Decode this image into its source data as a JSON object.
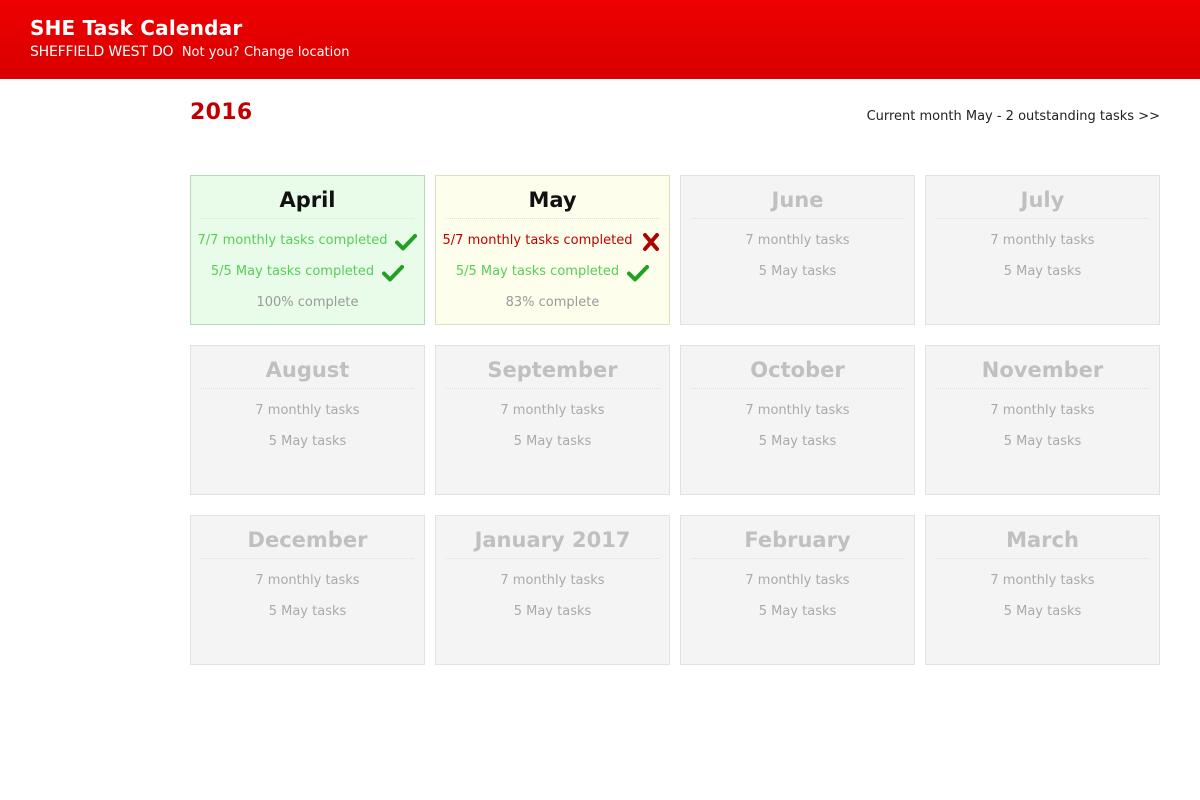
{
  "header": {
    "title": "SHE Task Calendar",
    "location": "SHEFFIELD WEST DO",
    "not_you": "Not you?",
    "change_link": "Change location"
  },
  "year": "2016",
  "current_month_link": "Current month May - 2 outstanding tasks >>",
  "colors": {
    "header_red": "#e80000",
    "year_red": "#c00000",
    "complete_green": "#55d055",
    "tick_green": "#22a022",
    "cross_red": "#b00000"
  },
  "months": [
    {
      "name": "April",
      "state": "completed",
      "lines": [
        {
          "text": "7/7 monthly tasks completed",
          "status": "ok",
          "icon": "check-icon"
        },
        {
          "text": "5/5 May tasks completed",
          "status": "ok",
          "icon": "check-icon"
        }
      ],
      "percent": "100% complete"
    },
    {
      "name": "May",
      "state": "current",
      "lines": [
        {
          "text": "5/7 monthly tasks completed",
          "status": "bad",
          "icon": "cross-icon"
        },
        {
          "text": "5/5 May tasks completed",
          "status": "ok",
          "icon": "check-icon"
        }
      ],
      "percent": "83% complete"
    },
    {
      "name": "June",
      "state": "future",
      "lines": [
        {
          "text": "7 monthly tasks"
        },
        {
          "text": "5 May tasks"
        }
      ]
    },
    {
      "name": "July",
      "state": "future",
      "lines": [
        {
          "text": "7 monthly tasks"
        },
        {
          "text": "5 May tasks"
        }
      ]
    },
    {
      "name": "August",
      "state": "future",
      "lines": [
        {
          "text": "7 monthly tasks"
        },
        {
          "text": "5 May tasks"
        }
      ]
    },
    {
      "name": "September",
      "state": "future",
      "lines": [
        {
          "text": "7 monthly tasks"
        },
        {
          "text": "5 May tasks"
        }
      ]
    },
    {
      "name": "October",
      "state": "future",
      "lines": [
        {
          "text": "7 monthly tasks"
        },
        {
          "text": "5 May tasks"
        }
      ]
    },
    {
      "name": "November",
      "state": "future",
      "lines": [
        {
          "text": "7 monthly tasks"
        },
        {
          "text": "5 May tasks"
        }
      ]
    },
    {
      "name": "December",
      "state": "future",
      "lines": [
        {
          "text": "7 monthly tasks"
        },
        {
          "text": "5 May tasks"
        }
      ]
    },
    {
      "name": "January 2017",
      "state": "future",
      "lines": [
        {
          "text": "7 monthly tasks"
        },
        {
          "text": "5 May tasks"
        }
      ]
    },
    {
      "name": "February",
      "state": "future",
      "lines": [
        {
          "text": "7 monthly tasks"
        },
        {
          "text": "5 May tasks"
        }
      ]
    },
    {
      "name": "March",
      "state": "future",
      "lines": [
        {
          "text": "7 monthly tasks"
        },
        {
          "text": "5 May tasks"
        }
      ]
    }
  ]
}
